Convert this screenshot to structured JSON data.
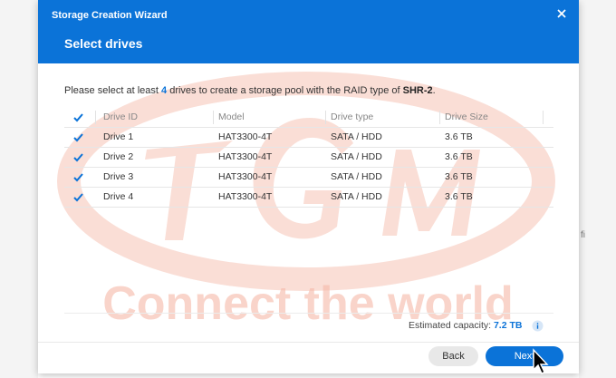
{
  "dialog": {
    "title": "Storage Creation Wizard",
    "step_title": "Select drives",
    "close_label": "×"
  },
  "instruction": {
    "prefix": "Please select at least ",
    "count": "4",
    "middle": " drives to create a storage pool with the RAID type of ",
    "raid_type": "SHR-2",
    "suffix": "."
  },
  "table": {
    "headers": {
      "id": "Drive ID",
      "model": "Model",
      "type": "Drive type",
      "size": "Drive Size"
    },
    "header_checked": true,
    "rows": [
      {
        "id": "Drive 1",
        "model": "HAT3300-4T",
        "type": "SATA / HDD",
        "size": "3.6 TB",
        "checked": true
      },
      {
        "id": "Drive 2",
        "model": "HAT3300-4T",
        "type": "SATA / HDD",
        "size": "3.6 TB",
        "checked": true
      },
      {
        "id": "Drive 3",
        "model": "HAT3300-4T",
        "type": "SATA / HDD",
        "size": "3.6 TB",
        "checked": true
      },
      {
        "id": "Drive 4",
        "model": "HAT3300-4T",
        "type": "SATA / HDD",
        "size": "3.6 TB",
        "checked": true
      }
    ]
  },
  "capacity": {
    "label": "Estimated capacity: ",
    "value": "7.2 TB"
  },
  "buttons": {
    "back": "Back",
    "next": "Next"
  },
  "watermark": {
    "text": "Connect the world",
    "color": "#f6b8a8"
  },
  "background": {
    "edge_text": "fi"
  },
  "colors": {
    "accent": "#0b73d8",
    "header_bg": "#0b73d8"
  }
}
